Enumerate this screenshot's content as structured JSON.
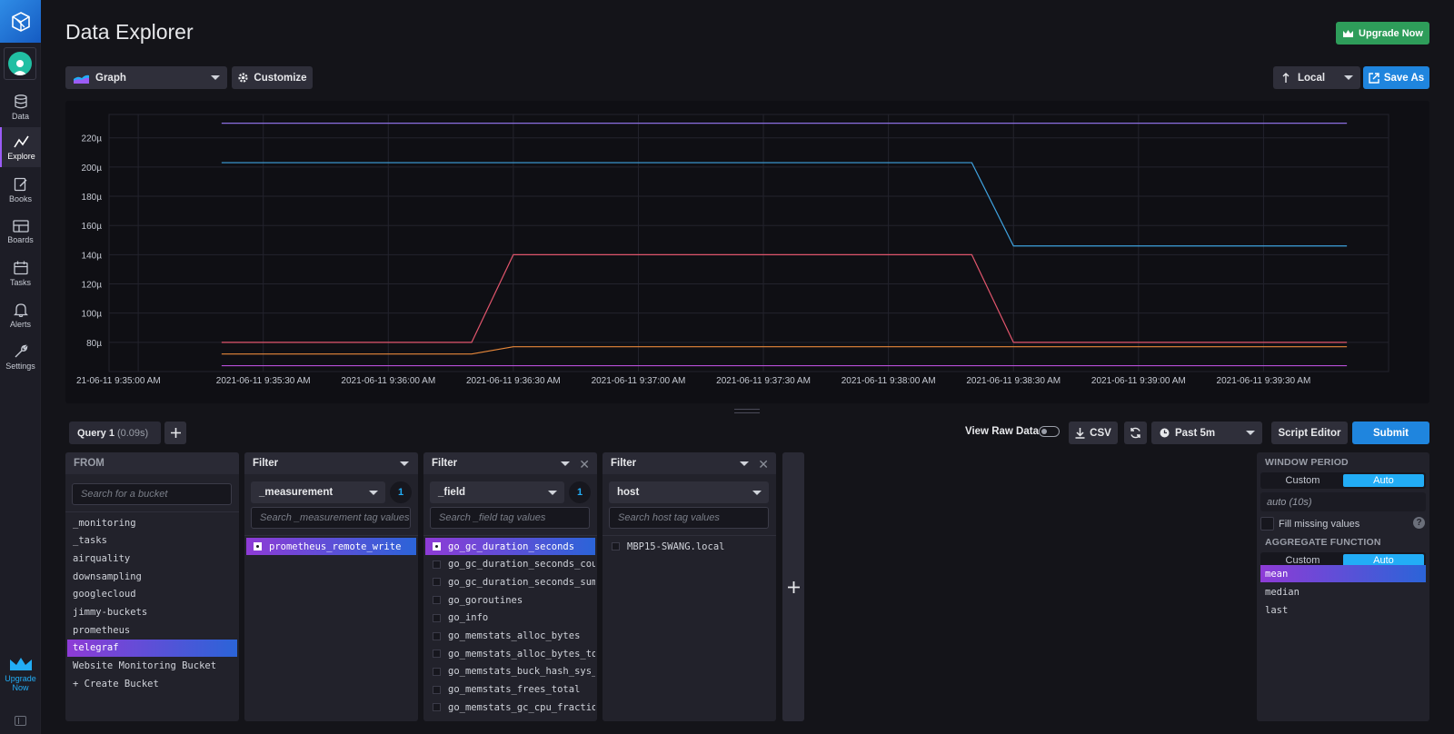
{
  "page": {
    "title": "Data Explorer",
    "upgrade_button": "Upgrade Now"
  },
  "sidebar": {
    "items": [
      {
        "label": "Data",
        "icon": "database-icon"
      },
      {
        "label": "Explore",
        "icon": "graph-icon",
        "active": true
      },
      {
        "label": "Books",
        "icon": "notebook-icon"
      },
      {
        "label": "Boards",
        "icon": "dashboard-icon"
      },
      {
        "label": "Tasks",
        "icon": "calendar-icon"
      },
      {
        "label": "Alerts",
        "icon": "bell-icon"
      },
      {
        "label": "Settings",
        "icon": "wrench-icon"
      }
    ],
    "upgrade_line1": "Upgrade",
    "upgrade_line2": "Now"
  },
  "toolbar": {
    "vis_type": "Graph",
    "customize": "Customize",
    "timezone": "Local",
    "save_as": "Save As"
  },
  "chart_data": {
    "type": "line",
    "y_ticks": [
      "80µ",
      "100µ",
      "120µ",
      "140µ",
      "160µ",
      "180µ",
      "200µ",
      "220µ"
    ],
    "ylim": [
      60,
      236
    ],
    "x_ticks": [
      "21-06-11 9:35:00 AM",
      "2021-06-11 9:35:30 AM",
      "2021-06-11 9:36:00 AM",
      "2021-06-11 9:36:30 AM",
      "2021-06-11 9:37:00 AM",
      "2021-06-11 9:37:30 AM",
      "2021-06-11 9:38:00 AM",
      "2021-06-11 9:38:30 AM",
      "2021-06-11 9:39:00 AM",
      "2021-06-11 9:39:30 AM"
    ],
    "x_tick_seconds": [
      0,
      30,
      60,
      90,
      120,
      150,
      180,
      210,
      240,
      270
    ],
    "xlim": [
      -7,
      300
    ],
    "grid": true,
    "series": [
      {
        "color": "#8b6fe0",
        "x": [
          20,
          290
        ],
        "y": [
          230,
          230
        ]
      },
      {
        "color": "#3fa3e0",
        "x": [
          20,
          200,
          210,
          290
        ],
        "y": [
          203,
          203,
          146,
          146
        ]
      },
      {
        "color": "#e0556c",
        "x": [
          20,
          80,
          90,
          200,
          210,
          290
        ],
        "y": [
          80,
          80,
          140,
          140,
          80,
          80
        ]
      },
      {
        "color": "#e8883a",
        "x": [
          20,
          80,
          90,
          290
        ],
        "y": [
          72,
          72,
          77,
          77
        ]
      },
      {
        "color": "#b64fd6",
        "x": [
          20,
          290
        ],
        "y": [
          64,
          64
        ]
      }
    ]
  },
  "query": {
    "tab_label": "Query 1",
    "tab_time": "(0.09s)",
    "view_raw": "View Raw Data",
    "csv": "CSV",
    "time_range": "Past 5m",
    "script_editor": "Script Editor",
    "submit": "Submit"
  },
  "from": {
    "header": "FROM",
    "search_placeholder": "Search for a bucket",
    "buckets": [
      "_monitoring",
      "_tasks",
      "airquality",
      "downsampling",
      "googlecloud",
      "jimmy-buckets",
      "prometheus",
      "telegraf",
      "Website Monitoring Bucket",
      "+ Create Bucket"
    ],
    "selected_index": 7
  },
  "filters": [
    {
      "header": "Filter",
      "key": "_measurement",
      "count": "1",
      "search_placeholder": "Search _measurement tag values",
      "values": [
        "prometheus_remote_write"
      ],
      "selected": [
        0
      ]
    },
    {
      "header": "Filter",
      "key": "_field",
      "count": "1",
      "search_placeholder": "Search _field tag values",
      "values": [
        "go_gc_duration_seconds",
        "go_gc_duration_seconds_count",
        "go_gc_duration_seconds_sum",
        "go_goroutines",
        "go_info",
        "go_memstats_alloc_bytes",
        "go_memstats_alloc_bytes_total",
        "go_memstats_buck_hash_sys_bytes",
        "go_memstats_frees_total",
        "go_memstats_gc_cpu_fraction"
      ],
      "selected": [
        0
      ]
    },
    {
      "header": "Filter",
      "key": "host",
      "count": "",
      "search_placeholder": "Search host tag values",
      "values": [
        "MBP15-SWANG.local"
      ],
      "selected": []
    }
  ],
  "window": {
    "title": "WINDOW PERIOD",
    "custom": "Custom",
    "auto": "Auto",
    "period_value": "auto (10s)",
    "fill_missing": "Fill missing values",
    "help": "?"
  },
  "aggregate": {
    "title": "AGGREGATE FUNCTION",
    "custom": "Custom",
    "auto": "Auto",
    "functions": [
      "mean",
      "median",
      "last"
    ],
    "selected_index": 0
  }
}
